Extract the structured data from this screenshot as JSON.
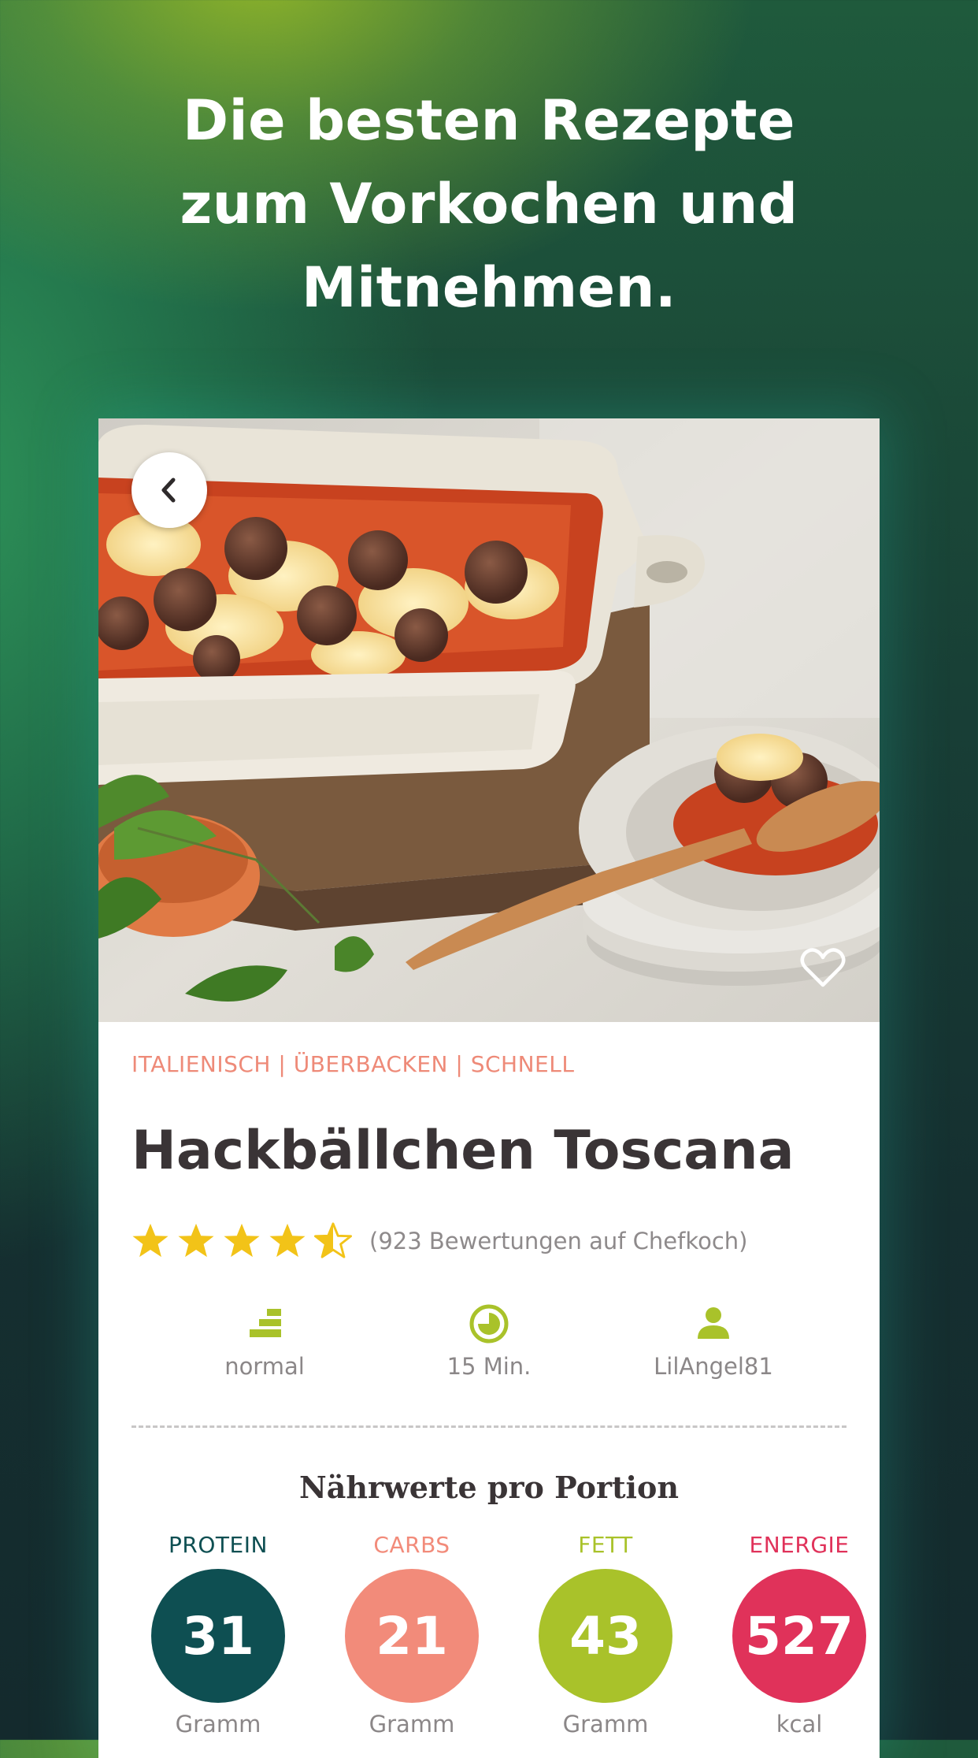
{
  "headline": {
    "line1": "Die besten Rezepte",
    "line2": "zum Vorkochen und",
    "line3": "Mitnehmen."
  },
  "recipe": {
    "tags": "ITALIENISCH | ÜBERBACKEN | SCHNELL",
    "title": "Hackbällchen Toscana",
    "rating": {
      "stars": 4.5,
      "max": 5,
      "text": "(923 Bewertungen auf Chefkoch)"
    },
    "meta": {
      "difficulty": {
        "icon": "difficulty-steps-icon",
        "label": "normal"
      },
      "time": {
        "icon": "clock-icon",
        "label": "15 Min."
      },
      "author": {
        "icon": "user-icon",
        "label": "LilAngel81"
      }
    }
  },
  "nutrition": {
    "title": "Nährwerte pro Portion",
    "items": [
      {
        "label": "PROTEIN",
        "value": "31",
        "unit": "Gramm",
        "color": "#0e4f52"
      },
      {
        "label": "CARBS",
        "value": "21",
        "unit": "Gramm",
        "color": "#f28b7a"
      },
      {
        "label": "FETT",
        "value": "43",
        "unit": "Gramm",
        "color": "#a9c22a"
      },
      {
        "label": "ENERGIE",
        "value": "527",
        "unit": "kcal",
        "color": "#e0325a"
      }
    ]
  },
  "colors": {
    "tag": "#ee8a78",
    "star": "#f2c318",
    "icon_accent": "#a9c22a",
    "title": "#3a3436"
  }
}
